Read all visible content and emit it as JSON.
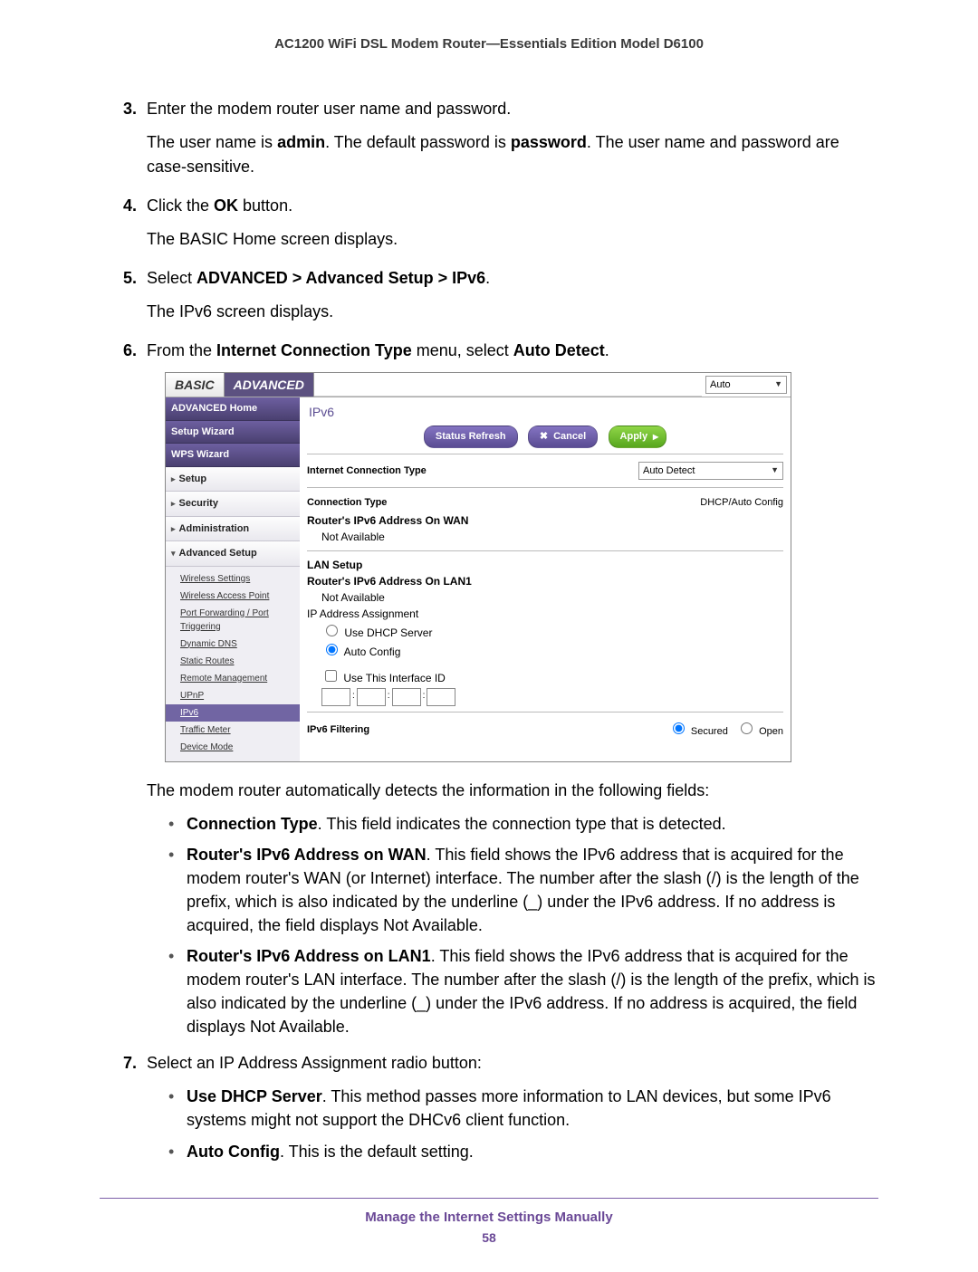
{
  "header": {
    "title": "AC1200 WiFi DSL Modem Router—Essentials Edition Model D6100"
  },
  "steps": {
    "s3": {
      "num": "3.",
      "line1": "Enter the modem router user name and password.",
      "line2a": "The user name is ",
      "line2b": "admin",
      "line2c": ". The default password is ",
      "line2d": "password",
      "line2e": ". The user name and password are case-sensitive."
    },
    "s4": {
      "num": "4.",
      "line1a": "Click the ",
      "line1b": "OK",
      "line1c": " button.",
      "line2": "The BASIC Home screen displays."
    },
    "s5": {
      "num": "5.",
      "line1a": "Select ",
      "line1b": "ADVANCED > Advanced Setup > IPv6",
      "line1c": ".",
      "line2": "The IPv6 screen displays."
    },
    "s6": {
      "num": "6.",
      "line1a": "From the ",
      "line1b": "Internet Connection Type",
      "line1c": " menu, select ",
      "line1d": "Auto Detect",
      "line1e": "."
    },
    "after6": "The modem router automatically detects the information in the following fields:",
    "b1": {
      "t": "Connection Type",
      "d": ". This field indicates the connection type that is detected."
    },
    "b2": {
      "t": "Router's IPv6 Address on WAN",
      "d": ". This field shows the IPv6 address that is acquired for the modem router's WAN (or Internet) interface. The number after the slash (/) is the length of the prefix, which is also indicated by the underline (_) under the IPv6 address. If no address is acquired, the field displays Not Available."
    },
    "b3": {
      "t": "Router's IPv6 Address on LAN1",
      "d": ". This field shows the IPv6 address that is acquired for the modem router's LAN interface. The number after the slash (/) is the length of the prefix, which is also indicated by the underline (_) under the IPv6 address. If no address is acquired, the field displays Not Available."
    },
    "s7": {
      "num": "7.",
      "line1": "Select an IP Address Assignment radio button:"
    },
    "b7a": {
      "t": "Use DHCP Server",
      "d": ". This method passes more information to LAN devices, but some IPv6 systems might not support the DHCv6 client function."
    },
    "b7b": {
      "t": "Auto Config",
      "d": ". This is the default setting."
    }
  },
  "router": {
    "tabs": {
      "basic": "BASIC",
      "advanced": "ADVANCED"
    },
    "lang": "Auto",
    "sidebar": {
      "home": "ADVANCED Home",
      "setupwiz": "Setup Wizard",
      "wps": "WPS Wizard",
      "setup": "Setup",
      "security": "Security",
      "admin": "Administration",
      "advsetup": "Advanced Setup",
      "subs": {
        "wls": "Wireless Settings",
        "wap": "Wireless Access Point",
        "pf": "Port Forwarding / Port Triggering",
        "ddns": "Dynamic DNS",
        "sr": "Static Routes",
        "rm": "Remote Management",
        "upnp": "UPnP",
        "ipv6": "IPv6",
        "tm": "Traffic Meter",
        "dm": "Device Mode"
      }
    },
    "pane": {
      "title": "IPv6",
      "btn_refresh": "Status Refresh",
      "btn_cancel": "Cancel",
      "btn_apply": "Apply",
      "ict_label": "Internet Connection Type",
      "ict_value": "Auto Detect",
      "ct_label": "Connection Type",
      "ct_value": "DHCP/Auto Config",
      "wan_label": "Router's IPv6 Address On WAN",
      "na": "Not Available",
      "lan_setup": "LAN Setup",
      "lan1_label": "Router's IPv6 Address On LAN1",
      "ipassign": "IP Address Assignment",
      "use_dhcp": "Use DHCP Server",
      "auto_cfg": "Auto Config",
      "use_iface": "Use This Interface ID",
      "filtering": "IPv6 Filtering",
      "secured": "Secured",
      "open": "Open"
    }
  },
  "footer": {
    "section": "Manage the Internet Settings Manually",
    "page": "58"
  }
}
